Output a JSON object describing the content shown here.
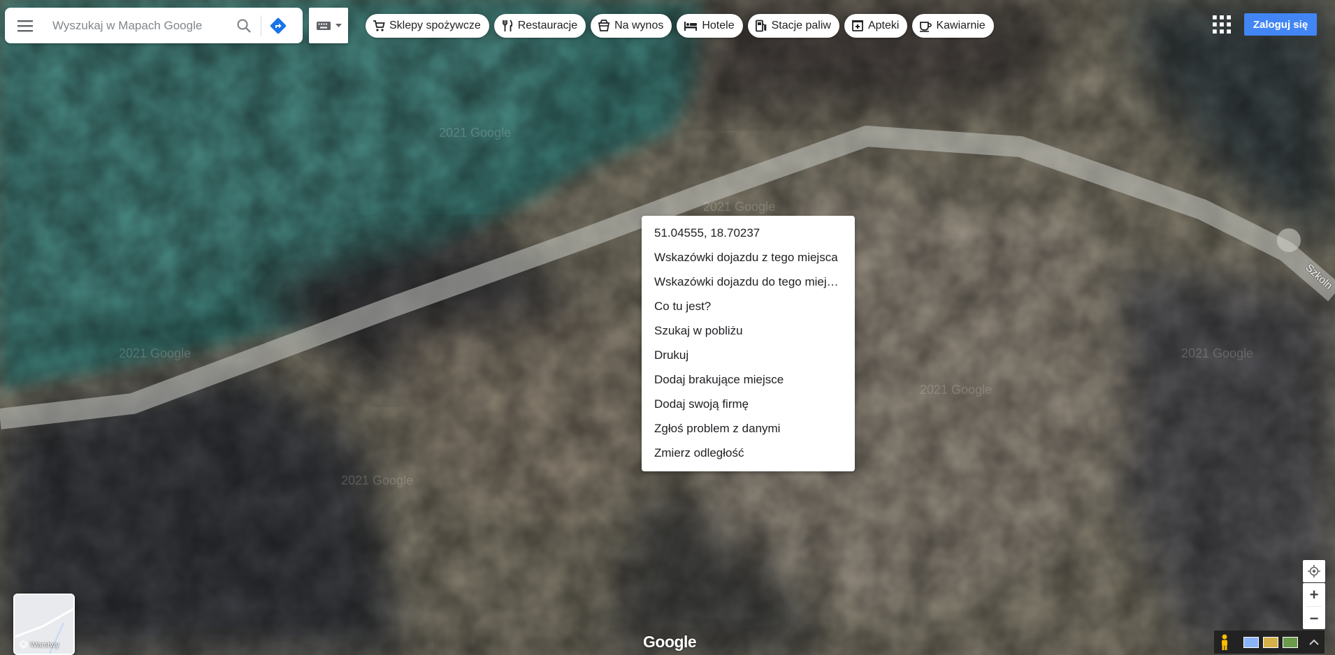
{
  "search": {
    "placeholder": "Wyszukaj w Mapach Google",
    "menu_icon": "hamburger-menu-icon",
    "search_icon": "search-icon",
    "directions_icon": "directions-icon"
  },
  "keyboard": {
    "icon": "keyboard-icon",
    "dropdown_icon": "caret-down-icon"
  },
  "chips": [
    {
      "label": "Sklepy spożywcze",
      "icon": "shopping-cart-icon"
    },
    {
      "label": "Restauracje",
      "icon": "restaurant-icon"
    },
    {
      "label": "Na wynos",
      "icon": "takeout-icon"
    },
    {
      "label": "Hotele",
      "icon": "hotel-bed-icon"
    },
    {
      "label": "Stacje paliw",
      "icon": "gas-station-icon"
    },
    {
      "label": "Apteki",
      "icon": "pharmacy-icon"
    },
    {
      "label": "Kawiarnie",
      "icon": "coffee-icon"
    }
  ],
  "header": {
    "apps_icon": "apps-grid-icon",
    "signin_label": "Zaloguj się"
  },
  "context_menu": {
    "items": [
      "51.04555, 18.70237",
      "Wskazówki dojazdu z tego miejsca",
      "Wskazówki dojazdu do tego miejsca",
      "Co tu jest?",
      "Szukaj w pobliżu",
      "Drukuj",
      "Dodaj brakujące miejsce",
      "Dodaj swoją firmę",
      "Zgłoś problem z danymi",
      "Zmierz odległość"
    ]
  },
  "map": {
    "road_label": "Szkoln",
    "watermark": "2021 Google",
    "brand": "Google",
    "layers_label": "Warstwy"
  },
  "controls": {
    "location_icon": "my-location-icon",
    "zoom_in": "+",
    "zoom_out": "−",
    "pegman_icon": "pegman-icon",
    "expand_icon": "chevron-up-icon"
  },
  "colors": {
    "accent": "#4285f4",
    "water": "#3f7f7a",
    "land": "#7d7466"
  }
}
